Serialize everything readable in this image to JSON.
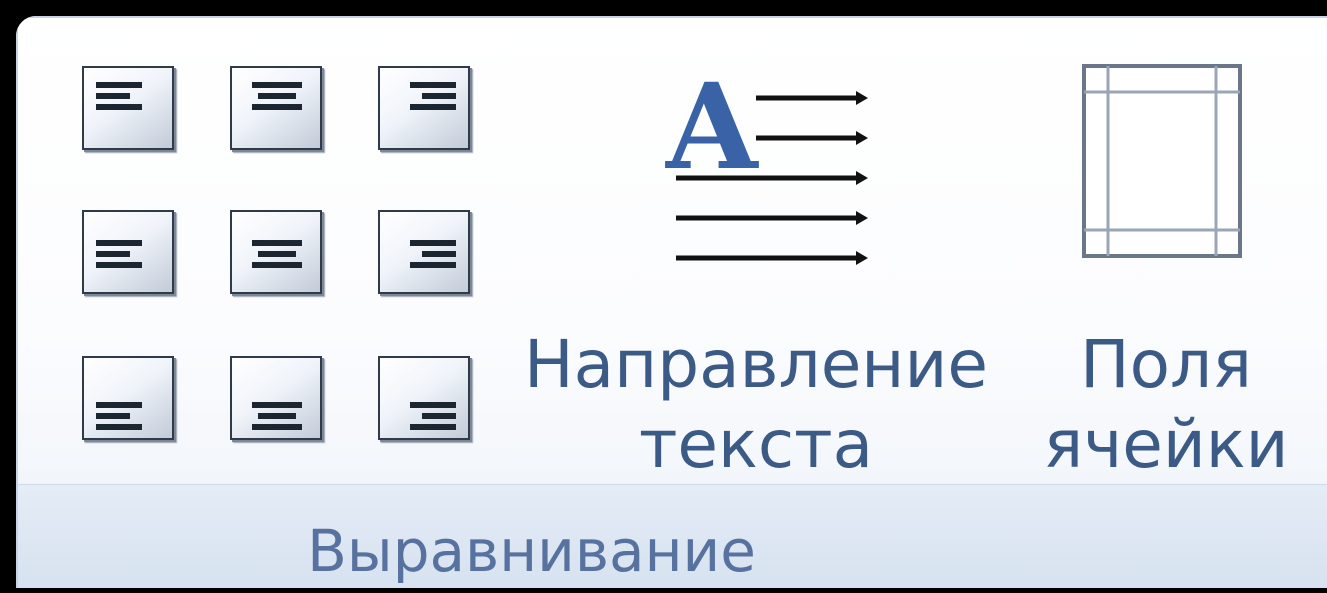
{
  "group": {
    "title": "Выравнивание",
    "align_buttons": [
      {
        "name": "align-top-left-button",
        "icon": "align-top-left-icon"
      },
      {
        "name": "align-top-center-button",
        "icon": "align-top-center-icon"
      },
      {
        "name": "align-top-right-button",
        "icon": "align-top-right-icon"
      },
      {
        "name": "align-middle-left-button",
        "icon": "align-middle-left-icon"
      },
      {
        "name": "align-middle-center-button",
        "icon": "align-middle-center-icon"
      },
      {
        "name": "align-middle-right-button",
        "icon": "align-middle-right-icon"
      },
      {
        "name": "align-bottom-left-button",
        "icon": "align-bottom-left-icon"
      },
      {
        "name": "align-bottom-center-button",
        "icon": "align-bottom-center-icon"
      },
      {
        "name": "align-bottom-right-button",
        "icon": "align-bottom-right-icon"
      }
    ],
    "text_direction": {
      "label_line1": "Направление",
      "label_line2": "текста",
      "icon": "text-direction-icon",
      "icon_letter": "A"
    },
    "cell_margins": {
      "label_line1": "Поля",
      "label_line2": "ячейки",
      "icon": "cell-margins-icon"
    }
  },
  "colors": {
    "label_text": "#3c5a86",
    "group_label_text": "#5872a0",
    "icon_letter": "#3a63a7"
  }
}
